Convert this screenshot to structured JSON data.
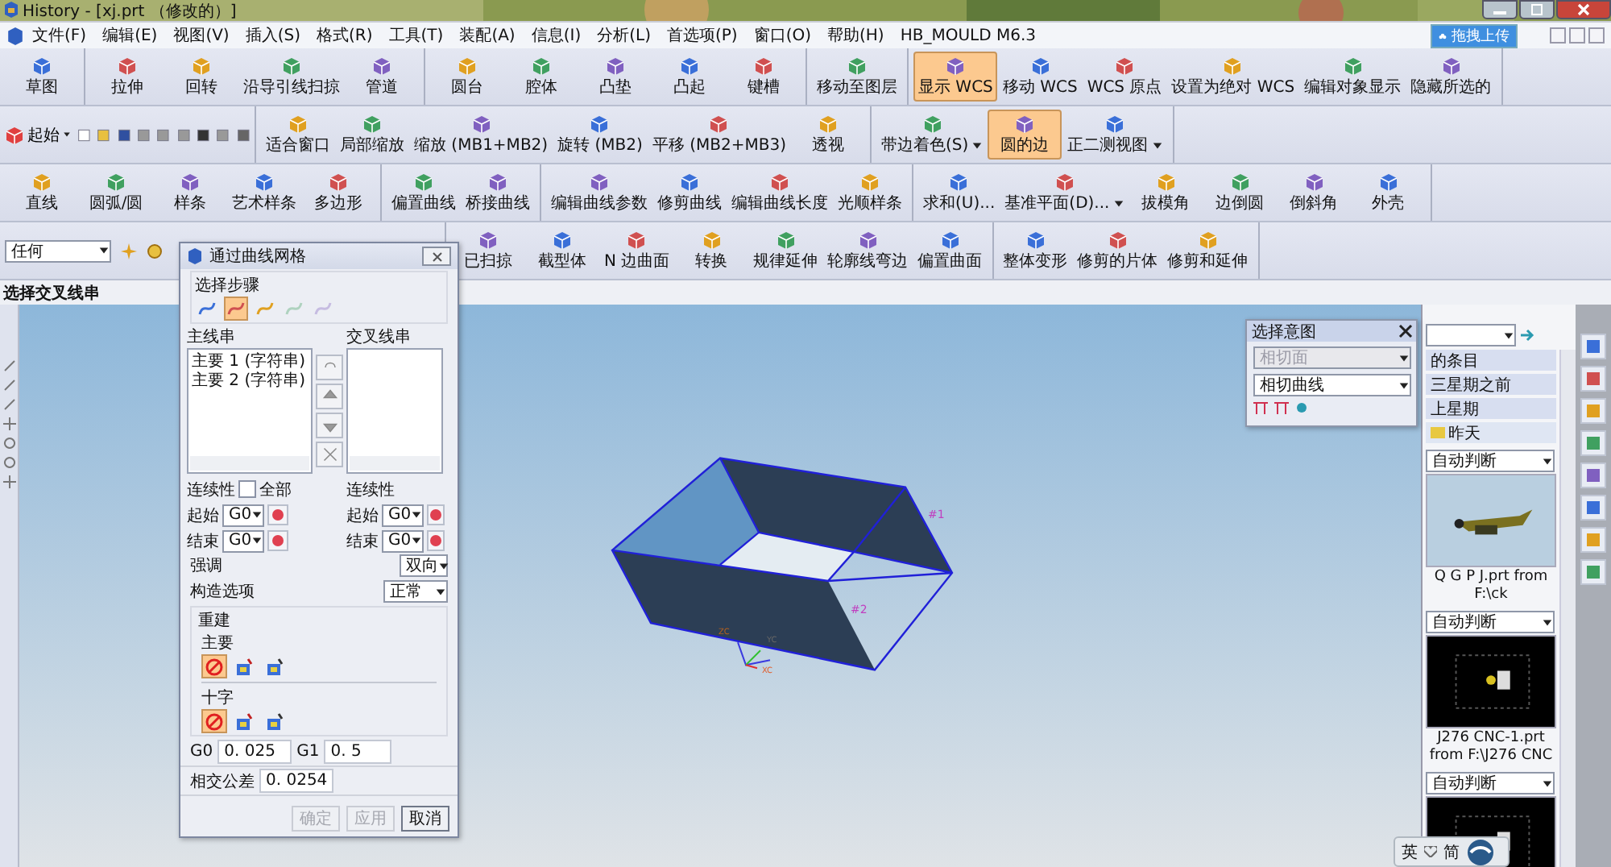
{
  "title": "History - [xj.prt （修改的）]",
  "menu": [
    "文件(F)",
    "编辑(E)",
    "视图(V)",
    "插入(S)",
    "格式(R)",
    "工具(T)",
    "装配(A)",
    "信息(I)",
    "分析(L)",
    "首选项(P)",
    "窗口(O)",
    "帮助(H)",
    "HB_MOULD M6.3"
  ],
  "upload_button": "拖拽上传",
  "toolbars": [
    {
      "groups": [
        {
          "items": [
            {
              "kind": "button",
              "label": "草图",
              "selected": false
            }
          ]
        },
        {
          "items": [
            {
              "kind": "button",
              "label": "拉伸",
              "selected": false
            },
            {
              "kind": "button",
              "label": "回转",
              "selected": false
            },
            {
              "kind": "button",
              "label": "沿导引线扫掠",
              "selected": false
            },
            {
              "kind": "button",
              "label": "管道",
              "selected": false
            }
          ]
        },
        {
          "items": [
            {
              "kind": "button",
              "label": "圆台",
              "selected": false
            },
            {
              "kind": "button",
              "label": "腔体",
              "selected": false
            },
            {
              "kind": "button",
              "label": "凸垫",
              "selected": false
            },
            {
              "kind": "button",
              "label": "凸起",
              "selected": false
            },
            {
              "kind": "button",
              "label": "键槽",
              "selected": false
            }
          ]
        },
        {
          "items": [
            {
              "kind": "button",
              "label": "移动至图层",
              "selected": false
            }
          ]
        },
        {
          "items": [
            {
              "kind": "button",
              "label": "显示 WCS",
              "selected": true
            },
            {
              "kind": "button",
              "label": "移动 WCS",
              "selected": false
            },
            {
              "kind": "button",
              "label": "WCS 原点",
              "selected": false
            },
            {
              "kind": "button",
              "label": "设置为绝对 WCS",
              "selected": false
            },
            {
              "kind": "button",
              "label": "编辑对象显示",
              "selected": false
            },
            {
              "kind": "button",
              "label": "隐藏所选的",
              "selected": false
            }
          ]
        }
      ]
    },
    {
      "groups": [
        {
          "items": [
            {
              "kind": "start",
              "label": "起始"
            }
          ]
        },
        {
          "items": [
            {
              "kind": "button",
              "label": "适合窗口",
              "selected": false
            },
            {
              "kind": "button",
              "label": "局部缩放",
              "selected": false
            },
            {
              "kind": "button",
              "label": "缩放 (MB1+MB2)",
              "selected": false
            },
            {
              "kind": "button",
              "label": "旋转 (MB2)",
              "selected": false
            },
            {
              "kind": "button",
              "label": "平移 (MB2+MB3)",
              "selected": false
            },
            {
              "kind": "button",
              "label": "透视",
              "selected": false
            }
          ]
        },
        {
          "items": [
            {
              "kind": "dropdown",
              "label": "带边着色(S)",
              "selected": false
            },
            {
              "kind": "button",
              "label": "圆的边",
              "selected": true
            },
            {
              "kind": "dropdown",
              "label": "正二测视图",
              "selected": false
            }
          ]
        }
      ]
    },
    {
      "groups": [
        {
          "items": [
            {
              "kind": "button",
              "label": "直线",
              "selected": false
            },
            {
              "kind": "button",
              "label": "圆弧/圆",
              "selected": false
            },
            {
              "kind": "button",
              "label": "样条",
              "selected": false
            },
            {
              "kind": "button",
              "label": "艺术样条",
              "selected": false
            },
            {
              "kind": "button",
              "label": "多边形",
              "selected": false
            }
          ]
        },
        {
          "items": [
            {
              "kind": "button",
              "label": "偏置曲线",
              "selected": false
            },
            {
              "kind": "button",
              "label": "桥接曲线",
              "selected": false
            }
          ]
        },
        {
          "items": [
            {
              "kind": "button",
              "label": "编辑曲线参数",
              "selected": false
            },
            {
              "kind": "button",
              "label": "修剪曲线",
              "selected": false
            },
            {
              "kind": "button",
              "label": "编辑曲线长度",
              "selected": false
            },
            {
              "kind": "button",
              "label": "光顺样条",
              "selected": false
            }
          ]
        },
        {
          "items": [
            {
              "kind": "button",
              "label": "求和(U)...",
              "selected": false
            },
            {
              "kind": "dropdown",
              "label": "基准平面(D)...",
              "selected": false
            },
            {
              "kind": "button",
              "label": "拔模角",
              "selected": false
            },
            {
              "kind": "button",
              "label": "边倒圆",
              "selected": false
            },
            {
              "kind": "button",
              "label": "倒斜角",
              "selected": false
            },
            {
              "kind": "button",
              "label": "外壳",
              "selected": false
            }
          ]
        }
      ]
    },
    {
      "groups": [
        {
          "items": [
            {
              "kind": "select",
              "label": "任何"
            }
          ]
        },
        {
          "items": [
            {
              "kind": "button",
              "label": "已扫掠",
              "selected": false
            },
            {
              "kind": "button",
              "label": "截型体",
              "selected": false
            },
            {
              "kind": "button",
              "label": "N 边曲面",
              "selected": false
            },
            {
              "kind": "button",
              "label": "转换",
              "selected": false
            },
            {
              "kind": "button",
              "label": "规律延伸",
              "selected": false
            },
            {
              "kind": "button",
              "label": "轮廓线弯边",
              "selected": false
            },
            {
              "kind": "button",
              "label": "偏置曲面",
              "selected": false
            }
          ]
        },
        {
          "items": [
            {
              "kind": "button",
              "label": "整体变形",
              "selected": false
            },
            {
              "kind": "button",
              "label": "修剪的片体",
              "selected": false
            },
            {
              "kind": "button",
              "label": "修剪和延伸",
              "selected": false
            }
          ]
        }
      ]
    }
  ],
  "status": "选择交叉线串",
  "canvas": {
    "tags": [
      "#1",
      "#2"
    ],
    "axes": [
      "ZC",
      "YC",
      "XC"
    ]
  },
  "dialog": {
    "title": "通过曲线网格",
    "steps_label": "选择步骤",
    "steps": [
      {
        "selected": false,
        "disabled": false
      },
      {
        "selected": true,
        "disabled": false
      },
      {
        "selected": false,
        "disabled": false
      },
      {
        "selected": false,
        "disabled": true
      },
      {
        "selected": false,
        "disabled": true
      }
    ],
    "primary": {
      "label": "主线串",
      "items": [
        "主要 1 (字符串)",
        "主要 2 (字符串)"
      ],
      "continuity_label": "连续性",
      "all_label": "全部",
      "all_checked": false,
      "start_label": "起始",
      "start_value": "G0",
      "end_label": "结束",
      "end_value": "G0"
    },
    "cross": {
      "label": "交叉线串",
      "continuity_label": "连续性",
      "start_label": "起始",
      "start_value": "G0",
      "end_label": "结束",
      "end_value": "G0"
    },
    "emphasis": {
      "label": "强调",
      "value": "双向"
    },
    "construction": {
      "label": "构造选项",
      "value": "正常"
    },
    "rebuild": {
      "label": "重建",
      "groups": [
        {
          "label": "主要",
          "options": [
            {
              "selected": true
            },
            {
              "selected": false
            },
            {
              "selected": false
            }
          ]
        },
        {
          "label": "十字",
          "options": [
            {
              "selected": true
            },
            {
              "selected": false
            },
            {
              "selected": false
            }
          ]
        }
      ]
    },
    "tolerances": [
      {
        "label": "G0",
        "value": "0. 025"
      },
      {
        "label": "G1",
        "value": "0. 5"
      }
    ],
    "intersect": {
      "label": "相交公差",
      "value": "0. 0254"
    },
    "buttons": [
      {
        "label": "确定",
        "disabled": true
      },
      {
        "label": "应用",
        "disabled": true
      },
      {
        "label": "取消",
        "disabled": false
      }
    ]
  },
  "selection_intent": {
    "title": "选择意图",
    "face_rule": {
      "value": "相切面",
      "disabled": true
    },
    "curve_rule": {
      "value": "相切曲线",
      "disabled": false
    }
  },
  "resource_panel": {
    "folders": [
      {
        "kind": "header",
        "label": "的条目"
      },
      {
        "kind": "header",
        "label": "三星期之前"
      },
      {
        "kind": "header",
        "label": "上星期"
      },
      {
        "kind": "folder",
        "label": "昨天"
      }
    ],
    "previews": [
      {
        "kind": "light",
        "mode": "自动判断",
        "caption": "Q G P J.prt from F:\\ck"
      },
      {
        "kind": "dark",
        "mode": "自动判断",
        "caption": "J276 CNC-1.prt from F:\\J276 CNC"
      },
      {
        "kind": "dark",
        "mode": "自动判断"
      }
    ]
  },
  "ime": {
    "items": [
      "英",
      "简"
    ]
  }
}
